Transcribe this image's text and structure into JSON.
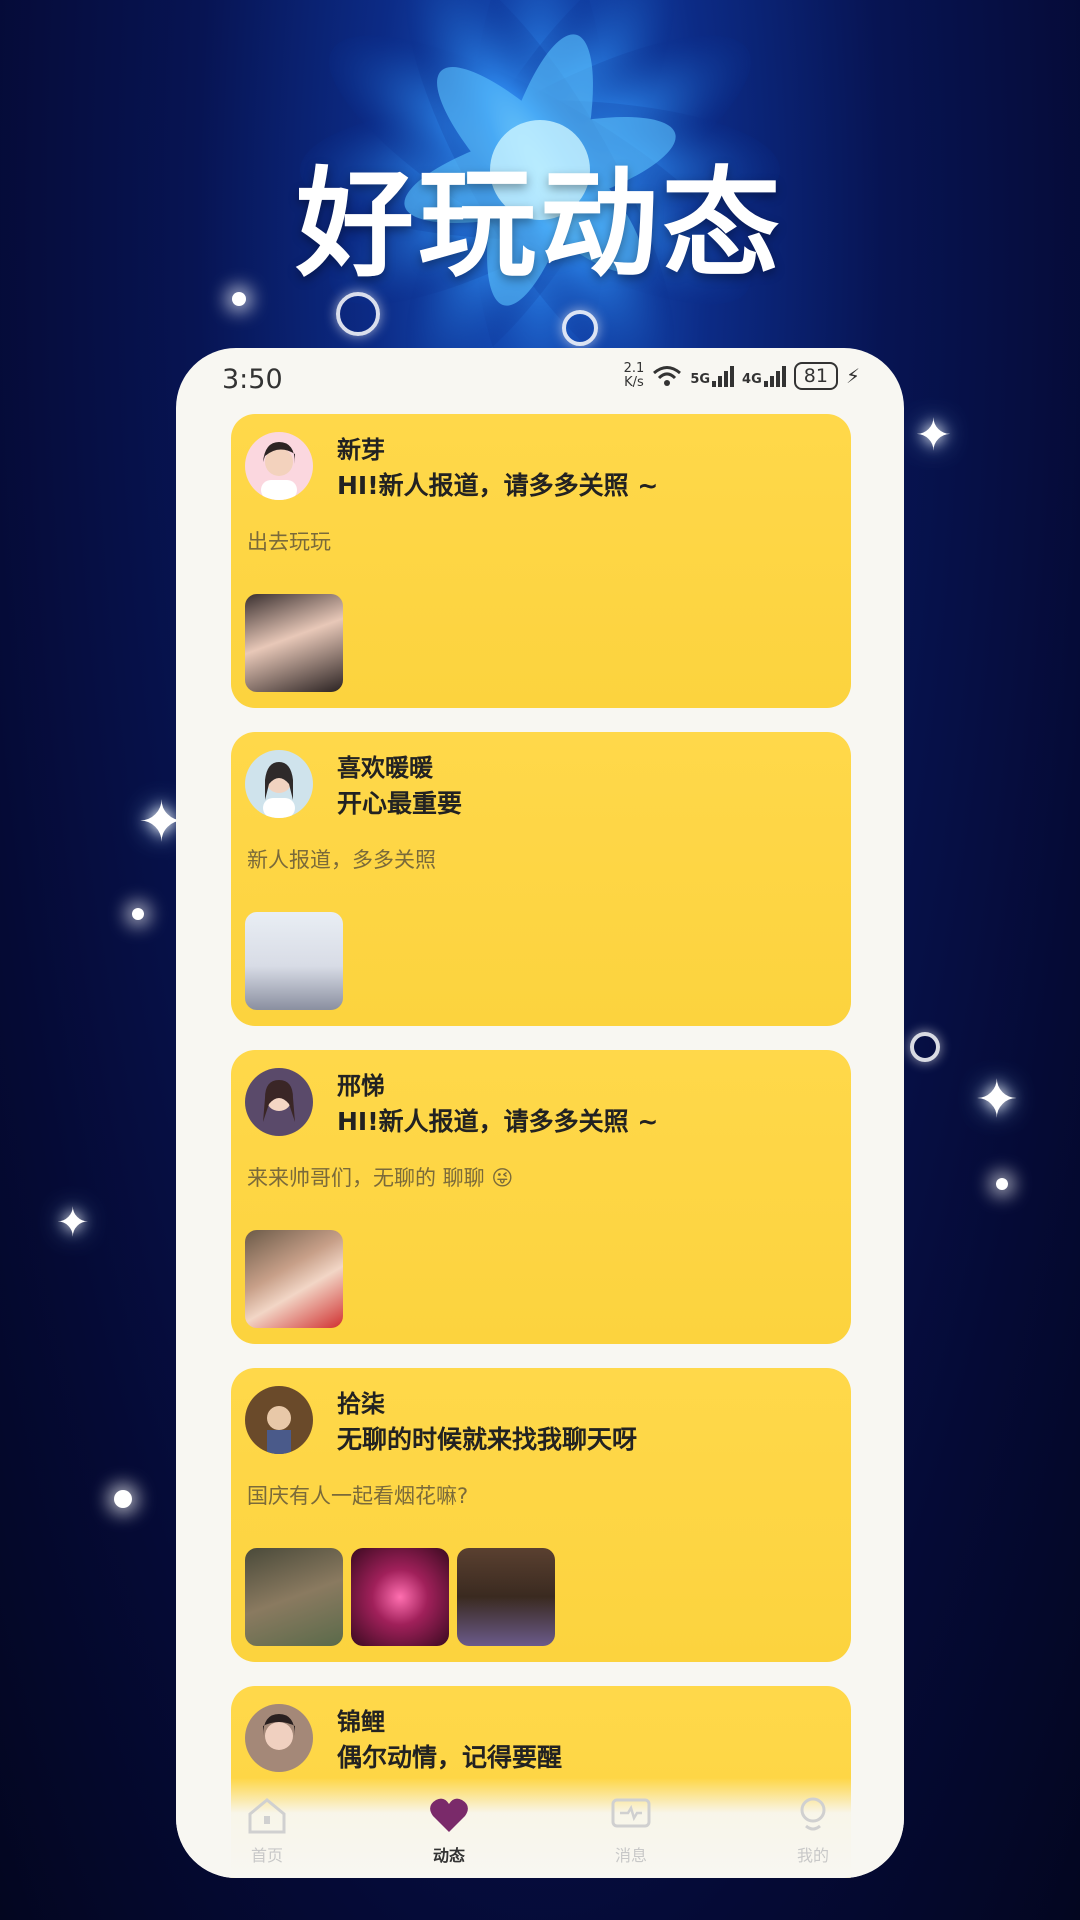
{
  "headline": "好玩动态",
  "status_bar": {
    "time": "3:50",
    "net_speed": "2.1",
    "net_unit": "K/s",
    "sim1": "5G",
    "sim2": "4G",
    "battery": "81"
  },
  "feed": [
    {
      "name": "新芽",
      "signature": "HI!新人报道，请多多关照 ~",
      "post": "出去玩玩",
      "photos": 1
    },
    {
      "name": "喜欢暖暖",
      "signature": "开心最重要",
      "post": "新人报道，多多关照",
      "photos": 1
    },
    {
      "name": "邢悌",
      "signature": "HI!新人报道，请多多关照 ~",
      "post": "来来帅哥们，无聊的 聊聊 😜",
      "photos": 1
    },
    {
      "name": "拾柒",
      "signature": "无聊的时候就来找我聊天呀",
      "post": "国庆有人一起看烟花嘛?",
      "photos": 3
    },
    {
      "name": "锦鲤",
      "signature": "偶尔动情，记得要醒",
      "post": "",
      "photos": 0
    }
  ],
  "tabs": [
    {
      "label": "首页",
      "icon": "home-icon",
      "active": false
    },
    {
      "label": "动态",
      "icon": "heart-icon",
      "active": true
    },
    {
      "label": "消息",
      "icon": "message-icon",
      "active": false
    },
    {
      "label": "我的",
      "icon": "profile-icon",
      "active": false
    }
  ],
  "colors": {
    "card": "#ffd84a",
    "background": "#071453",
    "phone": "#f8f7f2"
  }
}
